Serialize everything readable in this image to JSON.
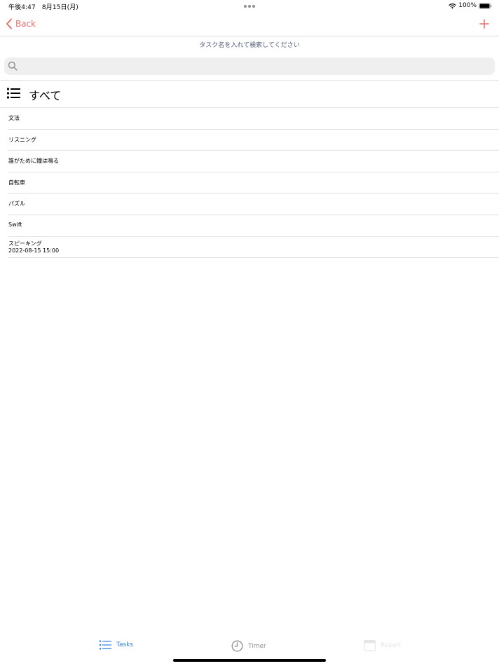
{
  "status_bar": {
    "time": "午後4:47　8月15日(月)",
    "battery": "100%",
    "icons": [
      "wifi-icon",
      "battery-icon",
      "more-dots-icon"
    ]
  },
  "nav": {
    "back_label": "Back",
    "back_icon": "chevron-left-icon",
    "add_icon": "plus-icon",
    "accent_color": "#e8706b"
  },
  "search": {
    "hint": "タスク名を入れて検索してください",
    "placeholder": "",
    "value": "",
    "icon": "search-icon"
  },
  "category": {
    "title": "すべて",
    "icon": "list-icon"
  },
  "tasks": [
    {
      "name": "文法"
    },
    {
      "name": "リスニング"
    },
    {
      "name": "誰がために鐘は鳴る"
    },
    {
      "name": "自転車"
    },
    {
      "name": "パズル"
    },
    {
      "name": "Swift"
    },
    {
      "name": "スピーキング",
      "date": "2022-08-15 15:00"
    }
  ],
  "tab_bar": {
    "tabs": [
      {
        "label": "Tasks",
        "icon": "list-icon",
        "state": "selected",
        "color": "#2f7de1"
      },
      {
        "label": "Timer",
        "icon": "clock-icon",
        "state": "normal",
        "color": "#8e8e93"
      },
      {
        "label": "Report",
        "icon": "calendar-icon",
        "state": "disabled",
        "color": "#e6e6e6"
      }
    ]
  }
}
